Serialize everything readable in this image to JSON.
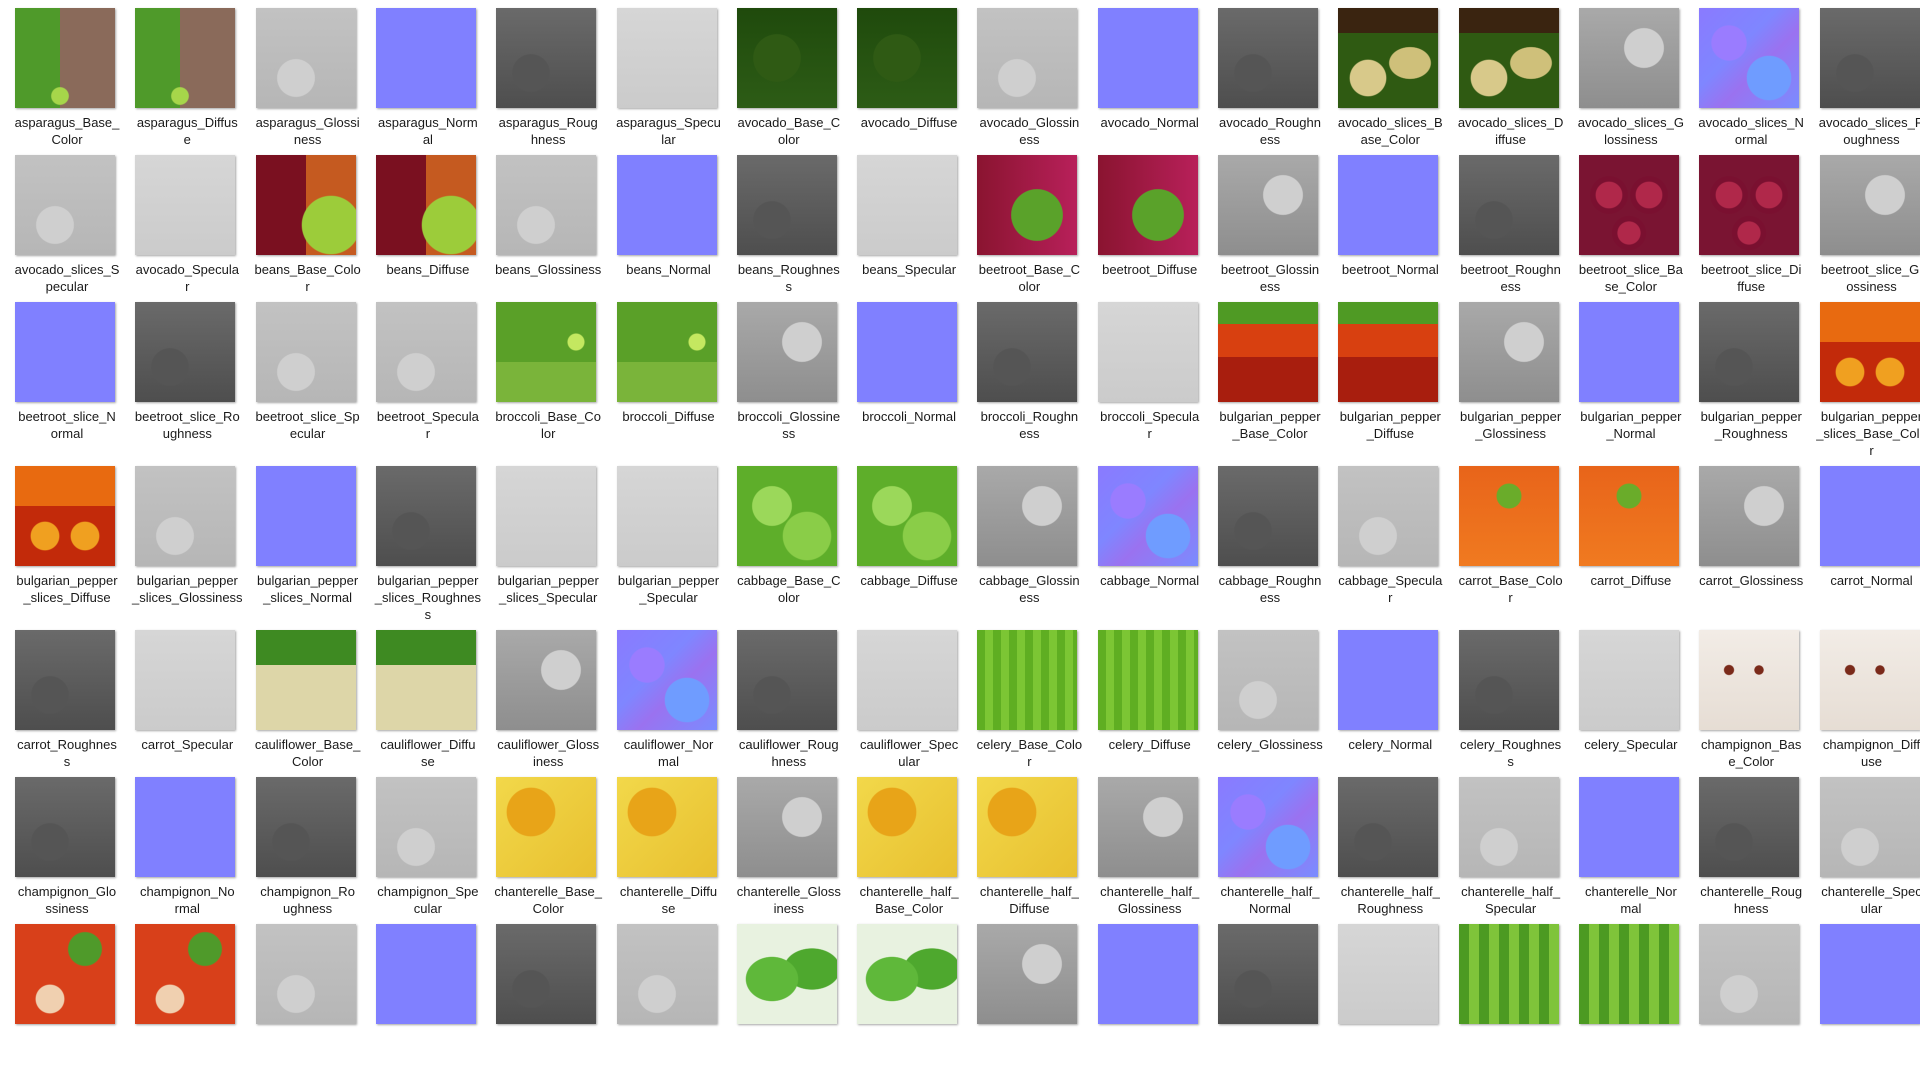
{
  "rows": [
    [
      {
        "name": "asparagus_Base_Color",
        "lines": [
          "asparagus_Base_",
          "Color"
        ],
        "type": "asparagus"
      },
      {
        "name": "asparagus_Diffuse",
        "lines": [
          "asparagus_Diffus",
          "e"
        ],
        "type": "asparagus"
      },
      {
        "name": "asparagus_Glossiness",
        "lines": [
          "asparagus_Glossi",
          "ness"
        ],
        "type": "gray-light"
      },
      {
        "name": "asparagus_Normal",
        "lines": [
          "asparagus_Norm",
          "al"
        ],
        "type": "normal"
      },
      {
        "name": "asparagus_Roughness",
        "lines": [
          "asparagus_Roug",
          "hness"
        ],
        "type": "gray-dark"
      },
      {
        "name": "asparagus_Specular",
        "lines": [
          "asparagus_Specu",
          "lar"
        ],
        "type": "gray-pale"
      },
      {
        "name": "avocado_Base_Color",
        "lines": [
          "avocado_Base_C",
          "olor"
        ],
        "type": "avocado-dark"
      },
      {
        "name": "avocado_Diffuse",
        "lines": [
          "avocado_Diffuse"
        ],
        "type": "avocado-dark"
      },
      {
        "name": "avocado_Glossiness",
        "lines": [
          "avocado_Glossin",
          "ess"
        ],
        "type": "gray-light"
      },
      {
        "name": "avocado_Normal",
        "lines": [
          "avocado_Normal"
        ],
        "type": "normal"
      },
      {
        "name": "avocado_Roughness",
        "lines": [
          "avocado_Roughn",
          "ess"
        ],
        "type": "gray-dark"
      },
      {
        "name": "avocado_slices_Base_Color",
        "lines": [
          "avocado_slices_B",
          "ase_Color"
        ],
        "type": "avocado-slices"
      },
      {
        "name": "avocado_slices_Diffuse",
        "lines": [
          "avocado_slices_D",
          "iffuse"
        ],
        "type": "avocado-slices"
      },
      {
        "name": "avocado_slices_Glossiness",
        "lines": [
          "avocado_slices_G",
          "lossiness"
        ],
        "type": "gray-mid"
      },
      {
        "name": "avocado_slices_Normal",
        "lines": [
          "avocado_slices_N",
          "ormal"
        ],
        "type": "normal-vivid"
      },
      {
        "name": "avocado_slices_Roughness",
        "lines": [
          "avocado_slices_R",
          "oughness"
        ],
        "type": "gray-dark"
      }
    ],
    [
      {
        "name": "avocado_slices_Specular",
        "lines": [
          "avocado_slices_S",
          "pecular"
        ],
        "type": "gray-light"
      },
      {
        "name": "avocado_Specular",
        "lines": [
          "avocado_Specula",
          "r"
        ],
        "type": "gray-pale"
      },
      {
        "name": "beans_Base_Color",
        "lines": [
          "beans_Base_Colo",
          "r"
        ],
        "type": "beans"
      },
      {
        "name": "beans_Diffuse",
        "lines": [
          "beans_Diffuse"
        ],
        "type": "beans"
      },
      {
        "name": "beans_Glossiness",
        "lines": [
          "beans_Glossiness"
        ],
        "type": "gray-light"
      },
      {
        "name": "beans_Normal",
        "lines": [
          "beans_Normal"
        ],
        "type": "normal"
      },
      {
        "name": "beans_Roughness",
        "lines": [
          "beans_Roughnes",
          "s"
        ],
        "type": "gray-dark"
      },
      {
        "name": "beans_Specular",
        "lines": [
          "beans_Specular"
        ],
        "type": "gray-pale"
      },
      {
        "name": "beetroot_Base_Color",
        "lines": [
          "beetroot_Base_C",
          "olor"
        ],
        "type": "beetroot"
      },
      {
        "name": "beetroot_Diffuse",
        "lines": [
          "beetroot_Diffuse"
        ],
        "type": "beetroot"
      },
      {
        "name": "beetroot_Glossiness",
        "lines": [
          "beetroot_Glossin",
          "ess"
        ],
        "type": "gray-mid"
      },
      {
        "name": "beetroot_Normal",
        "lines": [
          "beetroot_Normal"
        ],
        "type": "normal"
      },
      {
        "name": "beetroot_Roughness",
        "lines": [
          "beetroot_Roughn",
          "ess"
        ],
        "type": "gray-dark"
      },
      {
        "name": "beetroot_slice_Base_Color",
        "lines": [
          "beetroot_slice_Ba",
          "se_Color"
        ],
        "type": "beet-slice"
      },
      {
        "name": "beetroot_slice_Diffuse",
        "lines": [
          "beetroot_slice_Di",
          "ffuse"
        ],
        "type": "beet-slice"
      },
      {
        "name": "beetroot_slice_Glossiness",
        "lines": [
          "beetroot_slice_Gl",
          "ossiness"
        ],
        "type": "gray-mid"
      }
    ],
    [
      {
        "name": "beetroot_slice_Normal",
        "lines": [
          "beetroot_slice_N",
          "ormal"
        ],
        "type": "normal"
      },
      {
        "name": "beetroot_slice_Roughness",
        "lines": [
          "beetroot_slice_Ro",
          "ughness"
        ],
        "type": "gray-dark"
      },
      {
        "name": "beetroot_slice_Specular",
        "lines": [
          "beetroot_slice_Sp",
          "ecular"
        ],
        "type": "gray-light"
      },
      {
        "name": "beetroot_Specular",
        "lines": [
          "beetroot_Specula",
          "r"
        ],
        "type": "gray-light"
      },
      {
        "name": "broccoli_Base_Color",
        "lines": [
          "broccoli_Base_Co",
          "lor"
        ],
        "type": "broccoli"
      },
      {
        "name": "broccoli_Diffuse",
        "lines": [
          "broccoli_Diffuse"
        ],
        "type": "broccoli"
      },
      {
        "name": "broccoli_Glossiness",
        "lines": [
          "broccoli_Glossine",
          "ss"
        ],
        "type": "gray-mid"
      },
      {
        "name": "broccoli_Normal",
        "lines": [
          "broccoli_Normal"
        ],
        "type": "normal"
      },
      {
        "name": "broccoli_Roughness",
        "lines": [
          "broccoli_Roughn",
          "ess"
        ],
        "type": "gray-dark"
      },
      {
        "name": "broccoli_Specular",
        "lines": [
          "broccoli_Specula",
          "r"
        ],
        "type": "gray-pale"
      },
      {
        "name": "bulgarian_pepper_Base_Color",
        "lines": [
          "bulgarian_pepper",
          "_Base_Color"
        ],
        "type": "pepper"
      },
      {
        "name": "bulgarian_pepper_Diffuse",
        "lines": [
          "bulgarian_pepper",
          "_Diffuse"
        ],
        "type": "pepper"
      },
      {
        "name": "bulgarian_pepper_Glossiness",
        "lines": [
          "bulgarian_pepper",
          "_Glossiness"
        ],
        "type": "gray-mid"
      },
      {
        "name": "bulgarian_pepper_Normal",
        "lines": [
          "bulgarian_pepper",
          "_Normal"
        ],
        "type": "normal"
      },
      {
        "name": "bulgarian_pepper_Roughness",
        "lines": [
          "bulgarian_pepper",
          "_Roughness"
        ],
        "type": "gray-dark"
      },
      {
        "name": "bulgarian_pepper_slices_Base_Color",
        "lines": [
          "bulgarian_pepper",
          "_slices_Base_Colo",
          "r"
        ],
        "type": "pepper-slices"
      }
    ],
    [
      {
        "name": "bulgarian_pepper_slices_Diffuse",
        "lines": [
          "bulgarian_pepper",
          "_slices_Diffuse"
        ],
        "type": "pepper-slices"
      },
      {
        "name": "bulgarian_pepper_slices_Glossiness",
        "lines": [
          "bulgarian_pepper",
          "_slices_Glossiness"
        ],
        "type": "gray-light"
      },
      {
        "name": "bulgarian_pepper_slices_Normal",
        "lines": [
          "bulgarian_pepper",
          "_slices_Normal"
        ],
        "type": "normal"
      },
      {
        "name": "bulgarian_pepper_slices_Roughness",
        "lines": [
          "bulgarian_pepper",
          "_slices_Roughnes",
          "s"
        ],
        "type": "gray-dark"
      },
      {
        "name": "bulgarian_pepper_slices_Specular",
        "lines": [
          "bulgarian_pepper",
          "_slices_Specular"
        ],
        "type": "gray-pale"
      },
      {
        "name": "bulgarian_pepper_Specular",
        "lines": [
          "bulgarian_pepper",
          "_Specular"
        ],
        "type": "gray-pale"
      },
      {
        "name": "cabbage_Base_Color",
        "lines": [
          "cabbage_Base_C",
          "olor"
        ],
        "type": "cabbage"
      },
      {
        "name": "cabbage_Diffuse",
        "lines": [
          "cabbage_Diffuse"
        ],
        "type": "cabbage"
      },
      {
        "name": "cabbage_Glossiness",
        "lines": [
          "cabbage_Glossin",
          "ess"
        ],
        "type": "gray-mid"
      },
      {
        "name": "cabbage_Normal",
        "lines": [
          "cabbage_Normal"
        ],
        "type": "normal-vivid"
      },
      {
        "name": "cabbage_Roughness",
        "lines": [
          "cabbage_Roughn",
          "ess"
        ],
        "type": "gray-dark"
      },
      {
        "name": "cabbage_Specular",
        "lines": [
          "cabbage_Specula",
          "r"
        ],
        "type": "gray-light"
      },
      {
        "name": "carrot_Base_Color",
        "lines": [
          "carrot_Base_Colo",
          "r"
        ],
        "type": "carrot"
      },
      {
        "name": "carrot_Diffuse",
        "lines": [
          "carrot_Diffuse"
        ],
        "type": "carrot"
      },
      {
        "name": "carrot_Glossiness",
        "lines": [
          "carrot_Glossiness"
        ],
        "type": "gray-mid"
      },
      {
        "name": "carrot_Normal",
        "lines": [
          "carrot_Normal"
        ],
        "type": "normal"
      }
    ],
    [
      {
        "name": "carrot_Roughness",
        "lines": [
          "carrot_Roughnes",
          "s"
        ],
        "type": "gray-dark"
      },
      {
        "name": "carrot_Specular",
        "lines": [
          "carrot_Specular"
        ],
        "type": "gray-pale"
      },
      {
        "name": "cauliflower_Base_Color",
        "lines": [
          "cauliflower_Base_",
          "Color"
        ],
        "type": "cauliflower"
      },
      {
        "name": "cauliflower_Diffuse",
        "lines": [
          "cauliflower_Diffu",
          "se"
        ],
        "type": "cauliflower"
      },
      {
        "name": "cauliflower_Glossiness",
        "lines": [
          "cauliflower_Gloss",
          "iness"
        ],
        "type": "gray-mid"
      },
      {
        "name": "cauliflower_Normal",
        "lines": [
          "cauliflower_Nor",
          "mal"
        ],
        "type": "normal-vivid"
      },
      {
        "name": "cauliflower_Roughness",
        "lines": [
          "cauliflower_Roug",
          "hness"
        ],
        "type": "gray-dark"
      },
      {
        "name": "cauliflower_Specular",
        "lines": [
          "cauliflower_Spec",
          "ular"
        ],
        "type": "gray-pale"
      },
      {
        "name": "celery_Base_Color",
        "lines": [
          "celery_Base_Colo",
          "r"
        ],
        "type": "celery"
      },
      {
        "name": "celery_Diffuse",
        "lines": [
          "celery_Diffuse"
        ],
        "type": "celery"
      },
      {
        "name": "celery_Glossiness",
        "lines": [
          "celery_Glossiness"
        ],
        "type": "gray-light"
      },
      {
        "name": "celery_Normal",
        "lines": [
          "celery_Normal"
        ],
        "type": "normal"
      },
      {
        "name": "celery_Roughness",
        "lines": [
          "celery_Roughnes",
          "s"
        ],
        "type": "gray-dark"
      },
      {
        "name": "celery_Specular",
        "lines": [
          "celery_Specular"
        ],
        "type": "gray-pale"
      },
      {
        "name": "champignon_Base_Color",
        "lines": [
          "champignon_Bas",
          "e_Color"
        ],
        "type": "champignon"
      },
      {
        "name": "champignon_Diffuse",
        "lines": [
          "champignon_Diff",
          "use"
        ],
        "type": "champignon"
      }
    ],
    [
      {
        "name": "champignon_Glossiness",
        "lines": [
          "champignon_Glo",
          "ssiness"
        ],
        "type": "gray-dark"
      },
      {
        "name": "champignon_Normal",
        "lines": [
          "champignon_No",
          "rmal"
        ],
        "type": "normal"
      },
      {
        "name": "champignon_Roughness",
        "lines": [
          "champignon_Ro",
          "ughness"
        ],
        "type": "gray-dark"
      },
      {
        "name": "champignon_Specular",
        "lines": [
          "champignon_Spe",
          "cular"
        ],
        "type": "gray-light"
      },
      {
        "name": "chanterelle_Base_Color",
        "lines": [
          "chanterelle_Base_",
          "Color"
        ],
        "type": "chanterelle"
      },
      {
        "name": "chanterelle_Diffuse",
        "lines": [
          "chanterelle_Diffu",
          "se"
        ],
        "type": "chanterelle"
      },
      {
        "name": "chanterelle_Glossiness",
        "lines": [
          "chanterelle_Gloss",
          "iness"
        ],
        "type": "gray-mid"
      },
      {
        "name": "chanterelle_half_Base_Color",
        "lines": [
          "chanterelle_half_",
          "Base_Color"
        ],
        "type": "chanterelle"
      },
      {
        "name": "chanterelle_half_Diffuse",
        "lines": [
          "chanterelle_half_",
          "Diffuse"
        ],
        "type": "chanterelle"
      },
      {
        "name": "chanterelle_half_Glossiness",
        "lines": [
          "chanterelle_half_",
          "Glossiness"
        ],
        "type": "gray-mid"
      },
      {
        "name": "chanterelle_half_Normal",
        "lines": [
          "chanterelle_half_",
          "Normal"
        ],
        "type": "normal-vivid"
      },
      {
        "name": "chanterelle_half_Roughness",
        "lines": [
          "chanterelle_half_",
          "Roughness"
        ],
        "type": "gray-dark"
      },
      {
        "name": "chanterelle_half_Specular",
        "lines": [
          "chanterelle_half_",
          "Specular"
        ],
        "type": "gray-light"
      },
      {
        "name": "chanterelle_Normal",
        "lines": [
          "chanterelle_Nor",
          "mal"
        ],
        "type": "normal"
      },
      {
        "name": "chanterelle_Roughness",
        "lines": [
          "chanterelle_Roug",
          "hness"
        ],
        "type": "gray-dark"
      },
      {
        "name": "chanterelle_Specular",
        "lines": [
          "chanterelle_Spec",
          "ular"
        ],
        "type": "gray-light"
      }
    ],
    [
      {
        "name": "",
        "lines": [],
        "type": "chili"
      },
      {
        "name": "",
        "lines": [],
        "type": "chili"
      },
      {
        "name": "",
        "lines": [],
        "type": "gray-light"
      },
      {
        "name": "",
        "lines": [],
        "type": "normal"
      },
      {
        "name": "",
        "lines": [],
        "type": "gray-dark"
      },
      {
        "name": "",
        "lines": [],
        "type": "gray-light"
      },
      {
        "name": "",
        "lines": [],
        "type": "leaf"
      },
      {
        "name": "",
        "lines": [],
        "type": "leaf"
      },
      {
        "name": "",
        "lines": [],
        "type": "gray-mid"
      },
      {
        "name": "",
        "lines": [],
        "type": "normal"
      },
      {
        "name": "",
        "lines": [],
        "type": "gray-dark"
      },
      {
        "name": "",
        "lines": [],
        "type": "gray-pale"
      },
      {
        "name": "",
        "lines": [],
        "type": "corn"
      },
      {
        "name": "",
        "lines": [],
        "type": "corn"
      },
      {
        "name": "",
        "lines": [],
        "type": "gray-light"
      },
      {
        "name": "",
        "lines": [],
        "type": "normal"
      }
    ]
  ],
  "palette": {
    "normal": "#8080ff",
    "label_text": "#1a1a1a",
    "background": "#ffffff"
  }
}
